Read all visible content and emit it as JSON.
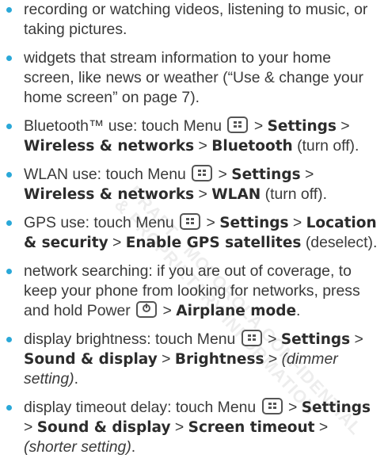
{
  "items": [
    {
      "runs": [
        {
          "t": "recording or watching videos, listening to music, or taking pictures."
        }
      ]
    },
    {
      "runs": [
        {
          "t": "widgets that stream information to your home screen, like news or weather (“Use & change your home screen” on page 7)."
        }
      ]
    },
    {
      "runs": [
        {
          "t": "Bluetooth™ use: touch Menu "
        },
        {
          "icon": "menu"
        },
        {
          "t": " > "
        },
        {
          "t": "Settings",
          "b": true
        },
        {
          "t": " > "
        },
        {
          "t": "Wireless & networks",
          "b": true
        },
        {
          "t": " > "
        },
        {
          "t": "Bluetooth",
          "b": true
        },
        {
          "t": " (turn off)."
        }
      ]
    },
    {
      "runs": [
        {
          "t": "WLAN use: touch Menu "
        },
        {
          "icon": "menu"
        },
        {
          "t": " > "
        },
        {
          "t": "Settings",
          "b": true
        },
        {
          "t": " > "
        },
        {
          "t": "Wireless & networks",
          "b": true
        },
        {
          "t": " > "
        },
        {
          "t": "WLAN",
          "b": true
        },
        {
          "t": " (turn off)."
        }
      ]
    },
    {
      "runs": [
        {
          "t": "GPS use: touch Menu "
        },
        {
          "icon": "menu"
        },
        {
          "t": " > "
        },
        {
          "t": "Settings",
          "b": true
        },
        {
          "t": " > "
        },
        {
          "t": "Location & security",
          "b": true
        },
        {
          "t": " > "
        },
        {
          "t": "Enable GPS satellites",
          "b": true
        },
        {
          "t": " (deselect)."
        }
      ]
    },
    {
      "runs": [
        {
          "t": "network searching: if you are out of coverage, to keep your phone from looking for networks, press and hold Power "
        },
        {
          "icon": "power"
        },
        {
          "t": " > "
        },
        {
          "t": "Airplane mode",
          "b": true
        },
        {
          "t": "."
        }
      ]
    },
    {
      "runs": [
        {
          "t": "display brightness: touch Menu "
        },
        {
          "icon": "menu"
        },
        {
          "t": " > "
        },
        {
          "t": "Settings",
          "b": true
        },
        {
          "t": " > "
        },
        {
          "t": "Sound & display",
          "b": true
        },
        {
          "t": " > "
        },
        {
          "t": "Brightness",
          "b": true
        },
        {
          "t": " > "
        },
        {
          "t": "(dimmer setting)",
          "i": true
        },
        {
          "t": "."
        }
      ]
    },
    {
      "runs": [
        {
          "t": "display timeout delay: touch Menu "
        },
        {
          "icon": "menu"
        },
        {
          "t": " > "
        },
        {
          "t": "Settings",
          "b": true
        },
        {
          "t": " > "
        },
        {
          "t": "Sound & display",
          "b": true
        },
        {
          "t": " > "
        },
        {
          "t": "Screen timeout",
          "b": true
        },
        {
          "t": " > "
        },
        {
          "t": "(shorter setting)",
          "i": true
        },
        {
          "t": "."
        }
      ]
    }
  ],
  "watermark": [
    "DRAFT - MOTOROLA CONFIDENTIAL",
    "& PROPRIETARY INFORMATION"
  ],
  "colors": {
    "bullet": "#2aa8d8",
    "text": "#3a3a3a"
  }
}
